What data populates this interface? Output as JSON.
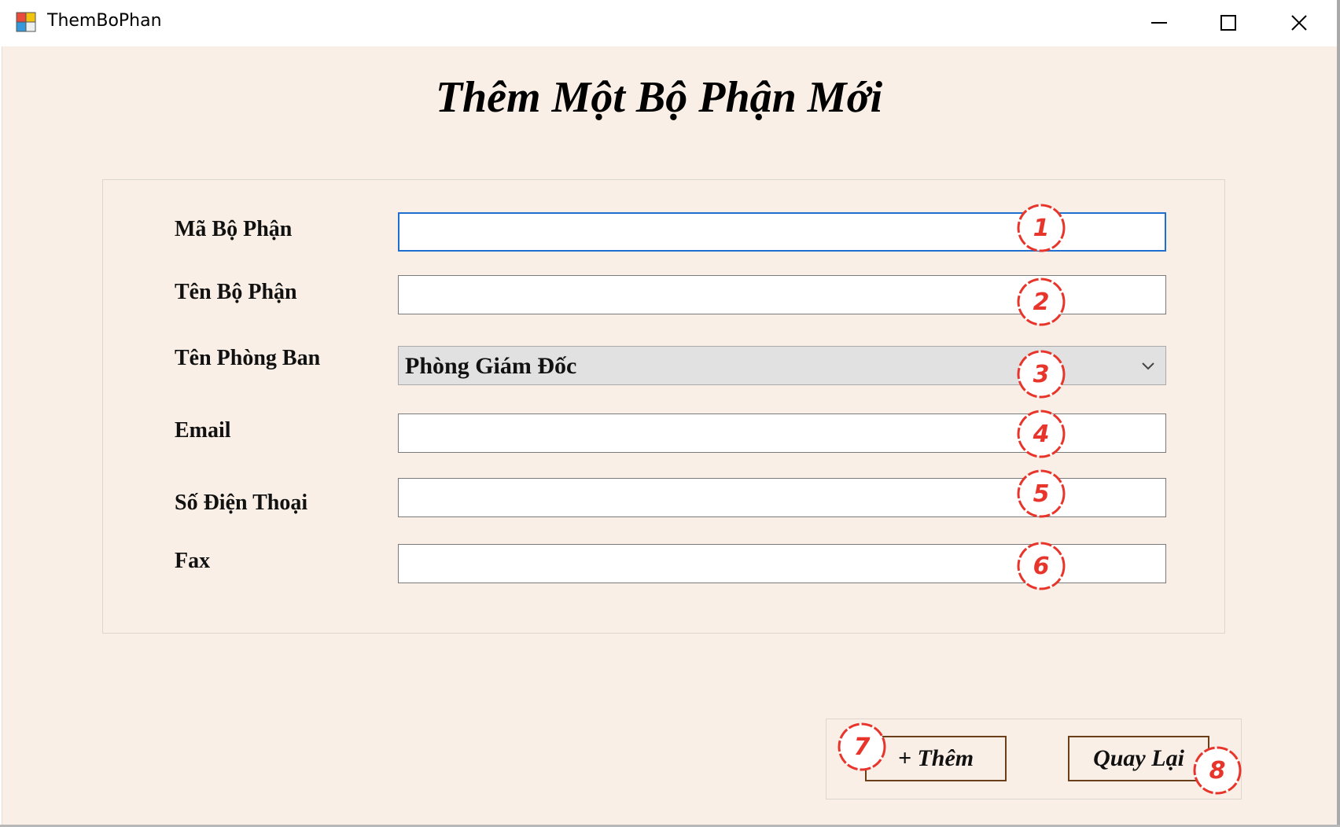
{
  "window": {
    "title": "ThemBoPhan"
  },
  "form": {
    "heading": "Thêm Một Bộ Phận Mới",
    "fields": [
      {
        "label": "Mã Bộ Phận",
        "value": "",
        "marker": "1"
      },
      {
        "label": "Tên Bộ Phận",
        "value": "",
        "marker": "2"
      },
      {
        "label": "Tên Phòng Ban",
        "value": "Phòng Giám Đốc",
        "marker": "3"
      },
      {
        "label": "Email",
        "value": "",
        "marker": "4"
      },
      {
        "label": "Số Điện Thoại",
        "value": "",
        "marker": "5"
      },
      {
        "label": "Fax",
        "value": "",
        "marker": "6"
      }
    ]
  },
  "buttons": {
    "add_label": "+ Thêm",
    "add_marker": "7",
    "back_label": "Quay Lại",
    "back_marker": "8"
  },
  "colors": {
    "client_background": "#f9efe6",
    "marker_red": "#e8352b",
    "button_border": "#6b3f19",
    "focus_blue": "#1f6fd0"
  },
  "icons": {
    "app": "winforms-app-icon",
    "minimize": "minimize-icon",
    "maximize": "maximize-icon",
    "close": "close-icon",
    "dropdown": "chevron-down-icon"
  }
}
